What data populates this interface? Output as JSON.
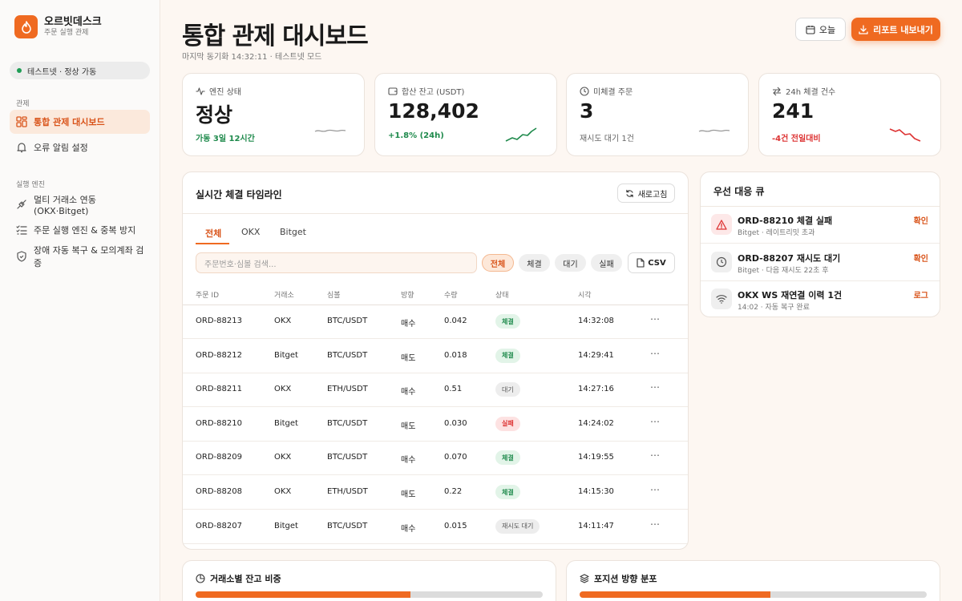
{
  "brand": {
    "name": "오르빗데스크",
    "subtitle": "주문 실행 관제"
  },
  "env_status": "테스트넷 · 정상 가동",
  "nav": {
    "section_monitor": "관제",
    "dashboard": "통합 관제 대시보드",
    "alerts": "오류 알림 설정",
    "section_engine": "실행 엔진",
    "multi_exchange": "멀티 거래소 연동 (OKX·Bitget)",
    "order_engine": "주문 실행 엔진 & 중복 방지",
    "recovery": "장애 자동 복구 & 모의계좌 검증"
  },
  "header": {
    "title": "통합 관제 대시보드",
    "subtitle": "마지막 동기화 14:32:11 · 테스트넷 모드",
    "today_label": "오늘",
    "export_label": "리포트 내보내기"
  },
  "stats": [
    {
      "label": "엔진 상태",
      "value": "정상",
      "foot": "가동 3일 12시간",
      "tone": "green"
    },
    {
      "label": "합산 잔고 (USDT)",
      "value": "128,402",
      "foot": "+1.8% (24h)",
      "tone": "green"
    },
    {
      "label": "미체결 주문",
      "value": "3",
      "foot": "재시도 대기 1건",
      "tone": "gray"
    },
    {
      "label": "24h 체결 건수",
      "value": "241",
      "foot": "-4건 전일대비",
      "tone": "red"
    }
  ],
  "timeline": {
    "title": "실시간 체결 타임라인",
    "refresh_label": "새로고침",
    "tabs": [
      "전체",
      "OKX",
      "Bitget"
    ],
    "search_placeholder": "주문번호·심볼 검색...",
    "chips": [
      "전체",
      "체결",
      "대기",
      "실패"
    ],
    "csv_label": "CSV",
    "columns": [
      "주문 ID",
      "거래소",
      "심볼",
      "방향",
      "수량",
      "상태",
      "시각"
    ],
    "rows": [
      {
        "id": "ORD-88213",
        "exchange": "OKX",
        "symbol": "BTC/USDT",
        "side": "매수",
        "qty": "0.042",
        "status": "체결",
        "status_tone": "green",
        "time": "14:32:08"
      },
      {
        "id": "ORD-88212",
        "exchange": "Bitget",
        "symbol": "BTC/USDT",
        "side": "매도",
        "qty": "0.018",
        "status": "체결",
        "status_tone": "green",
        "time": "14:29:41"
      },
      {
        "id": "ORD-88211",
        "exchange": "OKX",
        "symbol": "ETH/USDT",
        "side": "매수",
        "qty": "0.51",
        "status": "대기",
        "status_tone": "gray",
        "time": "14:27:16"
      },
      {
        "id": "ORD-88210",
        "exchange": "Bitget",
        "symbol": "BTC/USDT",
        "side": "매도",
        "qty": "0.030",
        "status": "실패",
        "status_tone": "red",
        "time": "14:24:02"
      },
      {
        "id": "ORD-88209",
        "exchange": "OKX",
        "symbol": "BTC/USDT",
        "side": "매수",
        "qty": "0.070",
        "status": "체결",
        "status_tone": "green",
        "time": "14:19:55"
      },
      {
        "id": "ORD-88208",
        "exchange": "OKX",
        "symbol": "ETH/USDT",
        "side": "매도",
        "qty": "0.22",
        "status": "체결",
        "status_tone": "green",
        "time": "14:15:30"
      },
      {
        "id": "ORD-88207",
        "exchange": "Bitget",
        "symbol": "BTC/USDT",
        "side": "매수",
        "qty": "0.015",
        "status": "재시도 대기",
        "status_tone": "gray",
        "time": "14:11:47"
      }
    ]
  },
  "queue": {
    "title": "우선 대응 큐",
    "items": [
      {
        "icon": "warning-icon",
        "title": "ORD-88210 체결 실패",
        "sub": "Bitget · 레이트리밋 초과",
        "action": "확인"
      },
      {
        "icon": "clock-icon",
        "title": "ORD-88207 재시도 대기",
        "sub": "Bitget · 다음 재시도 22초 후",
        "action": "확인"
      },
      {
        "icon": "wifi-icon",
        "title": "OKX WS 재연결 이력 1건",
        "sub": "14:02 · 자동 복구 완료",
        "action": "로그"
      }
    ]
  },
  "bottom": {
    "balance_title": "거래소별 잔고 비중",
    "balance_share": 0.62,
    "position_title": "포지션 방향 분포",
    "position_share": 0.55
  },
  "colors": {
    "accent": "#ef6a21",
    "green": "#1f8a4c",
    "red": "#dd3333"
  }
}
